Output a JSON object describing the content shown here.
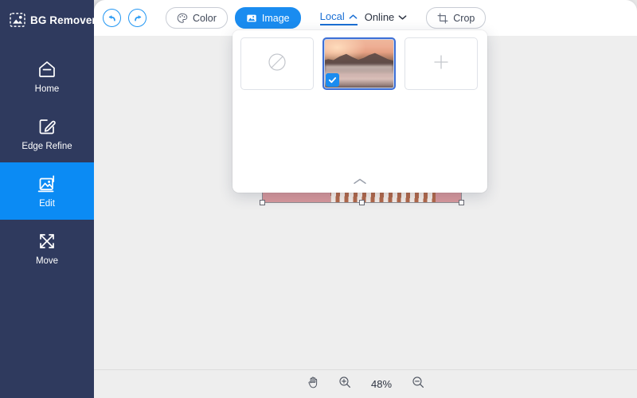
{
  "app": {
    "brand_name": "BG Remover",
    "logo_icon": "image-logo-icon"
  },
  "sidebar": {
    "items": [
      {
        "id": "home",
        "label": "Home",
        "icon": "home-icon",
        "active": false
      },
      {
        "id": "edge-refine",
        "label": "Edge Refine",
        "icon": "pen-square-icon",
        "active": false
      },
      {
        "id": "edit",
        "label": "Edit",
        "icon": "image-edit-icon",
        "active": true
      },
      {
        "id": "move",
        "label": "Move",
        "icon": "move-arrows-icon",
        "active": false
      }
    ]
  },
  "toolbar": {
    "undo_icon": "undo-arrow-icon",
    "redo_icon": "redo-arrow-icon",
    "color_label": "Color",
    "color_icon": "palette-icon",
    "image_label": "Image",
    "image_icon": "picture-icon",
    "crop_label": "Crop",
    "crop_icon": "crop-icon",
    "tabs": [
      {
        "id": "local",
        "label": "Local",
        "chevron": "chevron-up-icon",
        "active": true
      },
      {
        "id": "online",
        "label": "Online",
        "chevron": "chevron-down-icon",
        "active": false
      }
    ]
  },
  "image_panel": {
    "thumbnails": [
      {
        "id": "none",
        "type": "none",
        "icon": "no-image-icon",
        "selected": false
      },
      {
        "id": "sunset-lake",
        "type": "photo",
        "icon": "landscape-thumbnail",
        "selected": true,
        "badge_icon": "check-icon"
      },
      {
        "id": "add",
        "type": "add",
        "icon": "plus-icon",
        "selected": false
      }
    ],
    "collapse_icon": "chevron-up-icon"
  },
  "canvas": {
    "subject_alt": "woman in striped dress",
    "background_color": "#d8989d",
    "selection_handles": 8
  },
  "zoombar": {
    "hand_icon": "hand-icon",
    "zoom_in_icon": "zoom-in-icon",
    "zoom_out_icon": "zoom-out-icon",
    "zoom_level": "48%"
  },
  "colors": {
    "sidebar_bg": "#2f3a5e",
    "accent_blue": "#0b8bf4",
    "primary_button": "#1a8cf0",
    "tab_active": "#1a6fd4",
    "canvas_bg": "#eeeeee"
  }
}
